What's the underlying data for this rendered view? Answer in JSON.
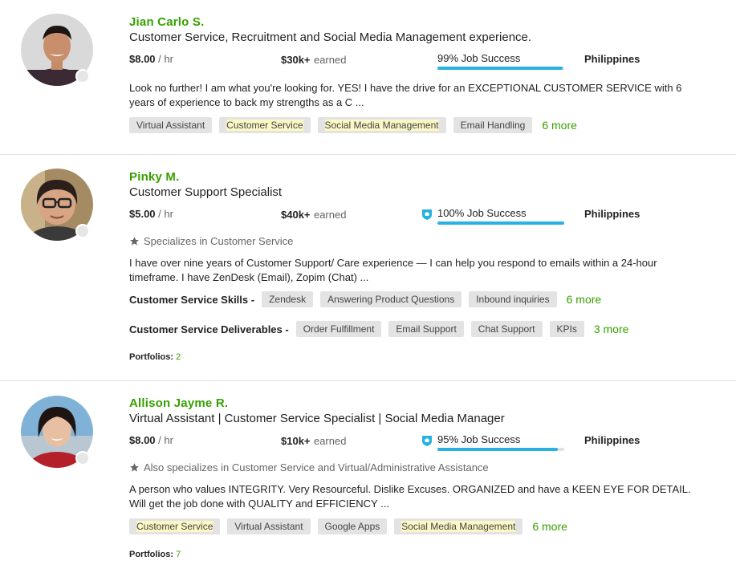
{
  "colors": {
    "accent_green": "#37a000",
    "bar_blue": "#29b2e1",
    "tag_bg": "#e3e3e3"
  },
  "freelancers": [
    {
      "name": "Jian Carlo S.",
      "title": "Customer Service, Recruitment and Social Media Management experience.",
      "rate": "$8.00",
      "rate_unit": "/ hr",
      "earned_amount": "$30k+",
      "earned_label": "earned",
      "job_success": "99% Job Success",
      "job_success_pct": 99,
      "top_rated": false,
      "country": "Philippines",
      "description_1": "Look no further! I am what you're looking for. YES! I have the drive for an EXCEPTIONAL CUSTOMER SERVICE with 6",
      "description_2": "years of experience to back my strengths as a C ...",
      "tags": [
        "Virtual Assistant",
        "Customer Service",
        "Social Media Management",
        "Email Handling"
      ],
      "more": "6 more"
    },
    {
      "name": "Pinky M.",
      "title": "Customer Support Specialist",
      "rate": "$5.00",
      "rate_unit": "/ hr",
      "earned_amount": "$40k+",
      "earned_label": "earned",
      "job_success": "100% Job Success",
      "job_success_pct": 100,
      "top_rated": true,
      "country": "Philippines",
      "specializes": "Specializes in Customer Service",
      "description_1": "I have over nine years of Customer Support/ Care experience — I can help you respond to emails within a 24-hour",
      "description_2": "timeframe. I have ZenDesk (Email), Zopim (Chat) ...",
      "skills_label": "Customer Service Skills -",
      "skills": [
        "Zendesk",
        "Answering Product Questions",
        "Inbound inquiries"
      ],
      "skills_more": "6 more",
      "deliverables_label": "Customer Service Deliverables -",
      "deliverables": [
        "Order Fulfillment",
        "Email Support",
        "Chat Support",
        "KPIs"
      ],
      "deliverables_more": "3 more",
      "portfolios_label": "Portfolios:",
      "portfolios_count": "2"
    },
    {
      "name": "Allison Jayme R.",
      "title": "Virtual Assistant | Customer Service Specialist | Social Media Manager",
      "rate": "$8.00",
      "rate_unit": "/ hr",
      "earned_amount": "$10k+",
      "earned_label": "earned",
      "job_success": "95% Job Success",
      "job_success_pct": 95,
      "top_rated": true,
      "country": "Philippines",
      "specializes": "Also specializes in Customer Service and Virtual/Administrative Assistance",
      "description_1": "A person who values INTEGRITY. Very Resourceful. Dislike Excuses. ORGANIZED and have a KEEN EYE FOR DETAIL.",
      "description_2": "Will get the job done with QUALITY and EFFICIENCY ...",
      "tags": [
        "Customer Service",
        "Virtual Assistant",
        "Google Apps",
        "Social Media Management"
      ],
      "more": "6 more",
      "portfolios_label": "Portfolios:",
      "portfolios_count": "7"
    }
  ]
}
